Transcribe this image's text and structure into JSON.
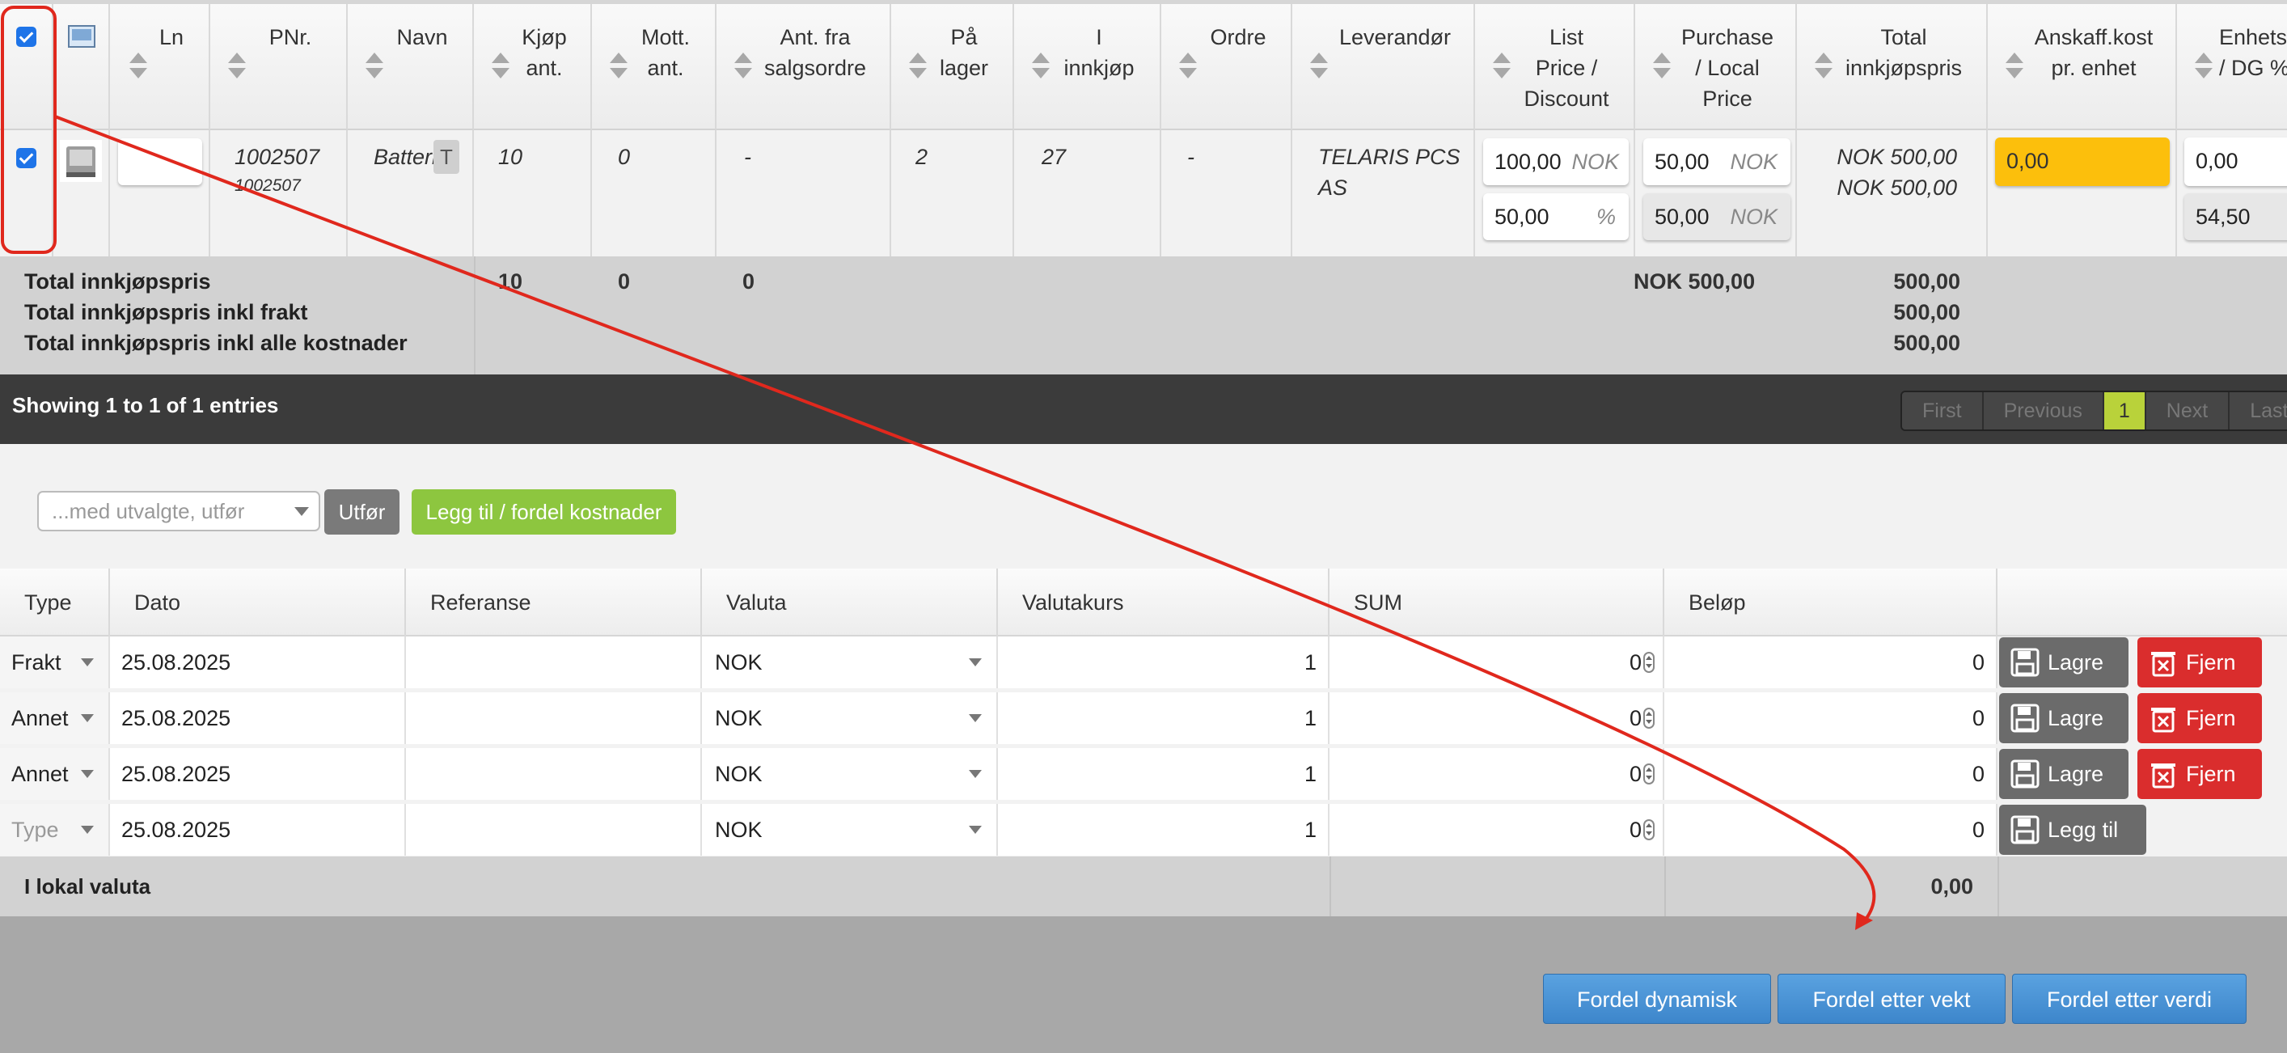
{
  "grid": {
    "columns": {
      "ln": "Ln",
      "pnr": "PNr.",
      "navn": "Navn",
      "kjop": "Kjøp\nant.",
      "mott": "Mott.\nant.",
      "antfra": "Ant. fra\nsalgsordre",
      "palager": "På\nlager",
      "innkjop": "I\ninnkjøp",
      "ordre": "Ordre",
      "leverandor": "Leverandør",
      "listprice": "List\nPrice /\nDiscount",
      "purchase": "Purchase\n/ Local\nPrice",
      "total": "Total\ninnkjøpspris",
      "anskaff": "Anskaff.kost\npr. enhet",
      "enhet": "Enhets\n/ DG %"
    },
    "row": {
      "pnr": "1002507",
      "pnr_sub": "1002507",
      "navn": "Batteri",
      "navn_badge": "T",
      "kjop": "10",
      "mott": "0",
      "antfra": "-",
      "palager": "2",
      "innkjop": "27",
      "ordre": "-",
      "leverandor": "TELARIS PCS\nAS",
      "list_price": "100,00",
      "list_currency": "NOK",
      "discount": "50,00",
      "discount_unit": "%",
      "purchase_price": "50,00",
      "purchase_currency": "NOK",
      "local_price": "50,00",
      "local_currency": "NOK",
      "total_1": "NOK 500,00",
      "total_2": "NOK 500,00",
      "anskaff": "0,00",
      "enhet_1": "0,00",
      "enhet_2": "54,50"
    },
    "totals": {
      "label_1": "Total innkjøpspris",
      "label_2": "Total innkjøpspris inkl frakt",
      "label_3": "Total innkjøpspris inkl alle kostnader",
      "kjop": "10",
      "mott": "0",
      "antfra": "0",
      "purchase_sum": "NOK 500,00",
      "total_1": "500,00",
      "total_2": "500,00",
      "total_3": "500,00"
    }
  },
  "pager": {
    "showing": "Showing 1 to 1 of 1 entries",
    "first": "First",
    "previous": "Previous",
    "current": "1",
    "next": "Next",
    "last": "Last"
  },
  "actions": {
    "bulk_placeholder": "...med utvalgte, utfør",
    "utfor": "Utfør",
    "legg_til_kostnader": "Legg til / fordel kostnader"
  },
  "costs": {
    "headers": {
      "type": "Type",
      "dato": "Dato",
      "referanse": "Referanse",
      "valuta": "Valuta",
      "valutakurs": "Valutakurs",
      "sum": "SUM",
      "belop": "Beløp"
    },
    "rows": [
      {
        "type": "Frakt",
        "dato": "25.08.2025",
        "referanse": "",
        "valuta": "NOK",
        "kurs": "1",
        "sum": "0",
        "belop": "0",
        "lagre": "Lagre",
        "fjern": "Fjern"
      },
      {
        "type": "Annet",
        "dato": "25.08.2025",
        "referanse": "",
        "valuta": "NOK",
        "kurs": "1",
        "sum": "0",
        "belop": "0",
        "lagre": "Lagre",
        "fjern": "Fjern"
      },
      {
        "type": "Annet",
        "dato": "25.08.2025",
        "referanse": "",
        "valuta": "NOK",
        "kurs": "1",
        "sum": "0",
        "belop": "0",
        "lagre": "Lagre",
        "fjern": "Fjern"
      }
    ],
    "new_row": {
      "type": "Type",
      "dato": "25.08.2025",
      "valuta": "NOK",
      "kurs": "1",
      "sum": "0",
      "belop": "0",
      "add": "Legg til"
    },
    "footer_label": "I lokal valuta",
    "footer_value": "0,00"
  },
  "distribute": {
    "dynamisk": "Fordel dynamisk",
    "vekt": "Fordel etter vekt",
    "verdi": "Fordel etter verdi"
  },
  "colors": {
    "accent_blue": "#3d86cb",
    "green": "#8dc63f",
    "red": "#da2d2d",
    "highlight_orange": "#fcbf0c",
    "annotation_red": "#e0281d"
  }
}
